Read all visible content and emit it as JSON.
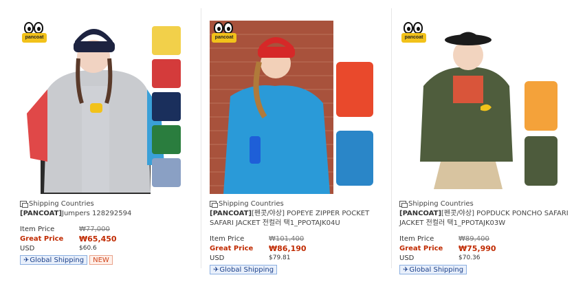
{
  "products": [
    {
      "logo_text": "pancoat",
      "shipping_label": "Shipping Countries",
      "brand": "[PANCOAT]",
      "title": "Jumpers 128292594",
      "item_price_label": "Item Price",
      "item_price": "₩77,000",
      "great_price_label": "Great Price",
      "great_price": "₩65,450",
      "usd_label": "USD",
      "usd_price": "$60.6",
      "tags": [
        "Global Shipping",
        "NEW"
      ],
      "image": "model in gray varsity jacket with beanie; four color variants shown at right",
      "colors": [
        "#f2d04a",
        "#d43b3b",
        "#1a2f5c",
        "#2a7d3e",
        "#8aa0c4"
      ]
    },
    {
      "logo_text": "pancoat",
      "shipping_label": "Shipping Countries",
      "brand": "[PANCOAT]",
      "title": "[펜콧/야상] POPEYE ZIPPER POCKET SAFARI JACKET 전컬러 택1_PPOTAJK04U",
      "item_price_label": "Item Price",
      "item_price": "₩101,400",
      "great_price_label": "Great Price",
      "great_price": "₩86,190",
      "usd_label": "USD",
      "usd_price": "$79.81",
      "tags": [
        "Global Shipping"
      ],
      "image": "model in blue safari jacket with red beanie against brick wall; orange and blue variants",
      "colors": [
        "#e9492c",
        "#2a86c8"
      ]
    },
    {
      "logo_text": "pancoat",
      "shipping_label": "Shipping Countries",
      "brand": "[PANCOAT]",
      "title": "[펜콧/야상] POPDUCK PONCHO SAFARI JACKET 전컬러 택1_PPOTAJK03W",
      "item_price_label": "Item Price",
      "item_price": "₩89,400",
      "great_price_label": "Great Price",
      "great_price": "₩75,990",
      "usd_label": "USD",
      "usd_price": "$70.36",
      "tags": [
        "Global Shipping"
      ],
      "image": "model in khaki poncho safari jacket with black hat; yellow and khaki variants",
      "colors": [
        "#f4a23a",
        "#4d5b3c"
      ]
    }
  ]
}
